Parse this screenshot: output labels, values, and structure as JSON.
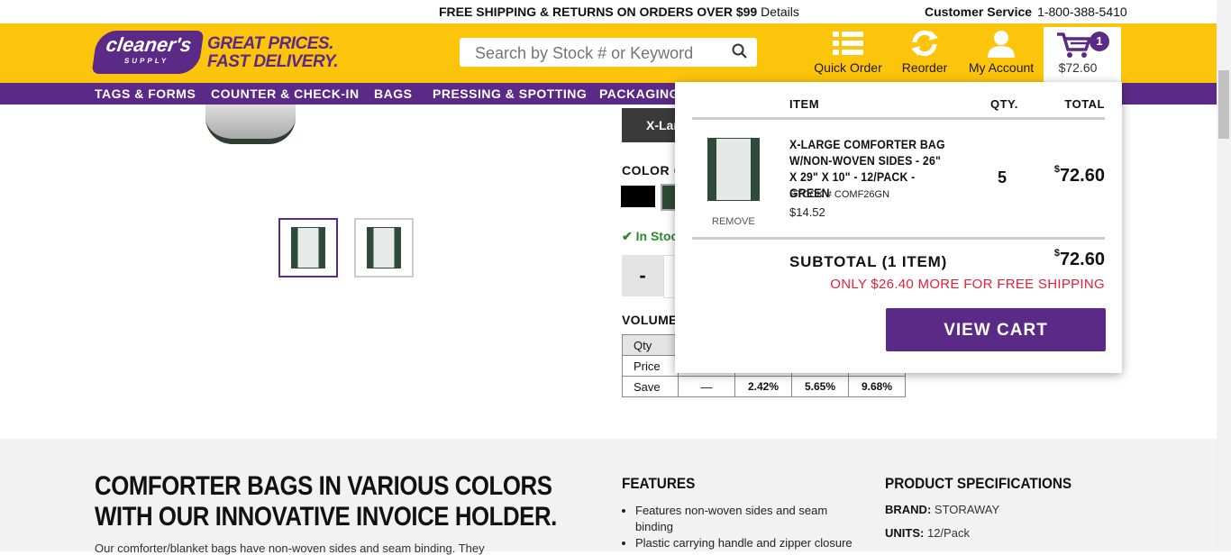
{
  "topbar": {
    "shipping": "FREE SHIPPING & RETURNS ON ORDERS OVER $99",
    "details": "Details",
    "cs_label": "Customer Service",
    "cs_phone": "1-800-388-5410"
  },
  "header": {
    "logo_line1": "cleaner's",
    "logo_line2": "SUPPLY",
    "tagline1": "GREAT PRICES.",
    "tagline2": "FAST DELIVERY.",
    "search_placeholder": "Search by Stock # or Keyword",
    "quick_order": "Quick Order",
    "reorder": "Reorder",
    "account": "My Account",
    "cart_count": "1",
    "cart_total": "$72.60"
  },
  "nav": [
    "TAGS & FORMS",
    "COUNTER & CHECK-IN",
    "BAGS",
    "PRESSING & SPOTTING",
    "PACKAGING"
  ],
  "product": {
    "size_selected": "X-Lar",
    "color_label": "COLOR",
    "color_value": "GR",
    "stock_status": "In Stoc",
    "qty_minus": "-",
    "volume_label": "VOLUME PR",
    "volume_table": {
      "rows": [
        [
          "Qty",
          "",
          "",
          "",
          ""
        ],
        [
          "Price",
          "",
          "",
          "",
          ""
        ],
        [
          "Save",
          "—",
          "2.42%",
          "5.65%",
          "9.68%"
        ]
      ]
    }
  },
  "cart_dropdown": {
    "col_item": "ITEM",
    "col_qty": "QTY.",
    "col_total": "TOTAL",
    "item_name": "X-LARGE COMFORTER BAG W/NON-WOVEN SIDES - 26\" X 29\" X 10\" - 12/PACK - GREEN",
    "item_stock": "STOCK # COMF26GN",
    "item_price": "$14.52",
    "item_remove": "REMOVE",
    "item_qty": "5",
    "item_total_sym": "$",
    "item_total": "72.60",
    "subtotal_label": "SUBTOTAL (1 ITEM)",
    "subtotal_sym": "$",
    "subtotal": "72.60",
    "free_ship_msg": "ONLY $26.40 MORE FOR FREE SHIPPING",
    "view_cart": "VIEW CART"
  },
  "details": {
    "headline1": "COMFORTER BAGS IN VARIOUS COLORS",
    "headline2": "WITH OUR INNOVATIVE INVOICE HOLDER.",
    "body": "Our comforter/blanket bags have non-woven sides and seam binding. They",
    "features_title": "FEATURES",
    "features": [
      "Features non-woven sides and seam binding",
      "Plastic carrying handle and zipper closure"
    ],
    "specs_title": "PRODUCT SPECIFICATIONS",
    "brand_label": "BRAND:",
    "brand_value": "STORAWAY",
    "units_label": "UNITS:",
    "units_value": "12/Pack"
  },
  "colors": {
    "brand_purple": "#5b2a86",
    "header_yellow": "#fdc40c",
    "alert_red": "#e0223a",
    "stock_green": "#2a8a2a"
  }
}
